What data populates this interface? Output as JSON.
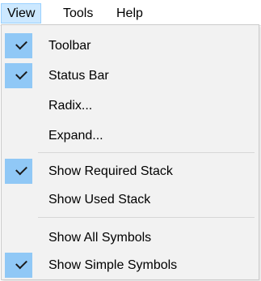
{
  "menubar": {
    "items": [
      {
        "label": "View",
        "active": true
      },
      {
        "label": "Tools"
      },
      {
        "label": "Help"
      }
    ]
  },
  "menu": {
    "items": [
      {
        "label": "Toolbar",
        "checked": true
      },
      {
        "label": "Status Bar",
        "checked": true
      },
      {
        "label": "Radix...",
        "checked": false
      },
      {
        "label": "Expand...",
        "checked": false
      },
      {
        "label": "Show Required Stack",
        "checked": true
      },
      {
        "label": "Show Used Stack",
        "checked": false
      },
      {
        "label": "Show All Symbols",
        "checked": false
      },
      {
        "label": "Show Simple Symbols",
        "checked": true
      }
    ]
  },
  "colors": {
    "menubar_active_bg": "#cce8ff",
    "check_highlight": "#90c8f6",
    "menu_bg": "#f2f2f2"
  }
}
